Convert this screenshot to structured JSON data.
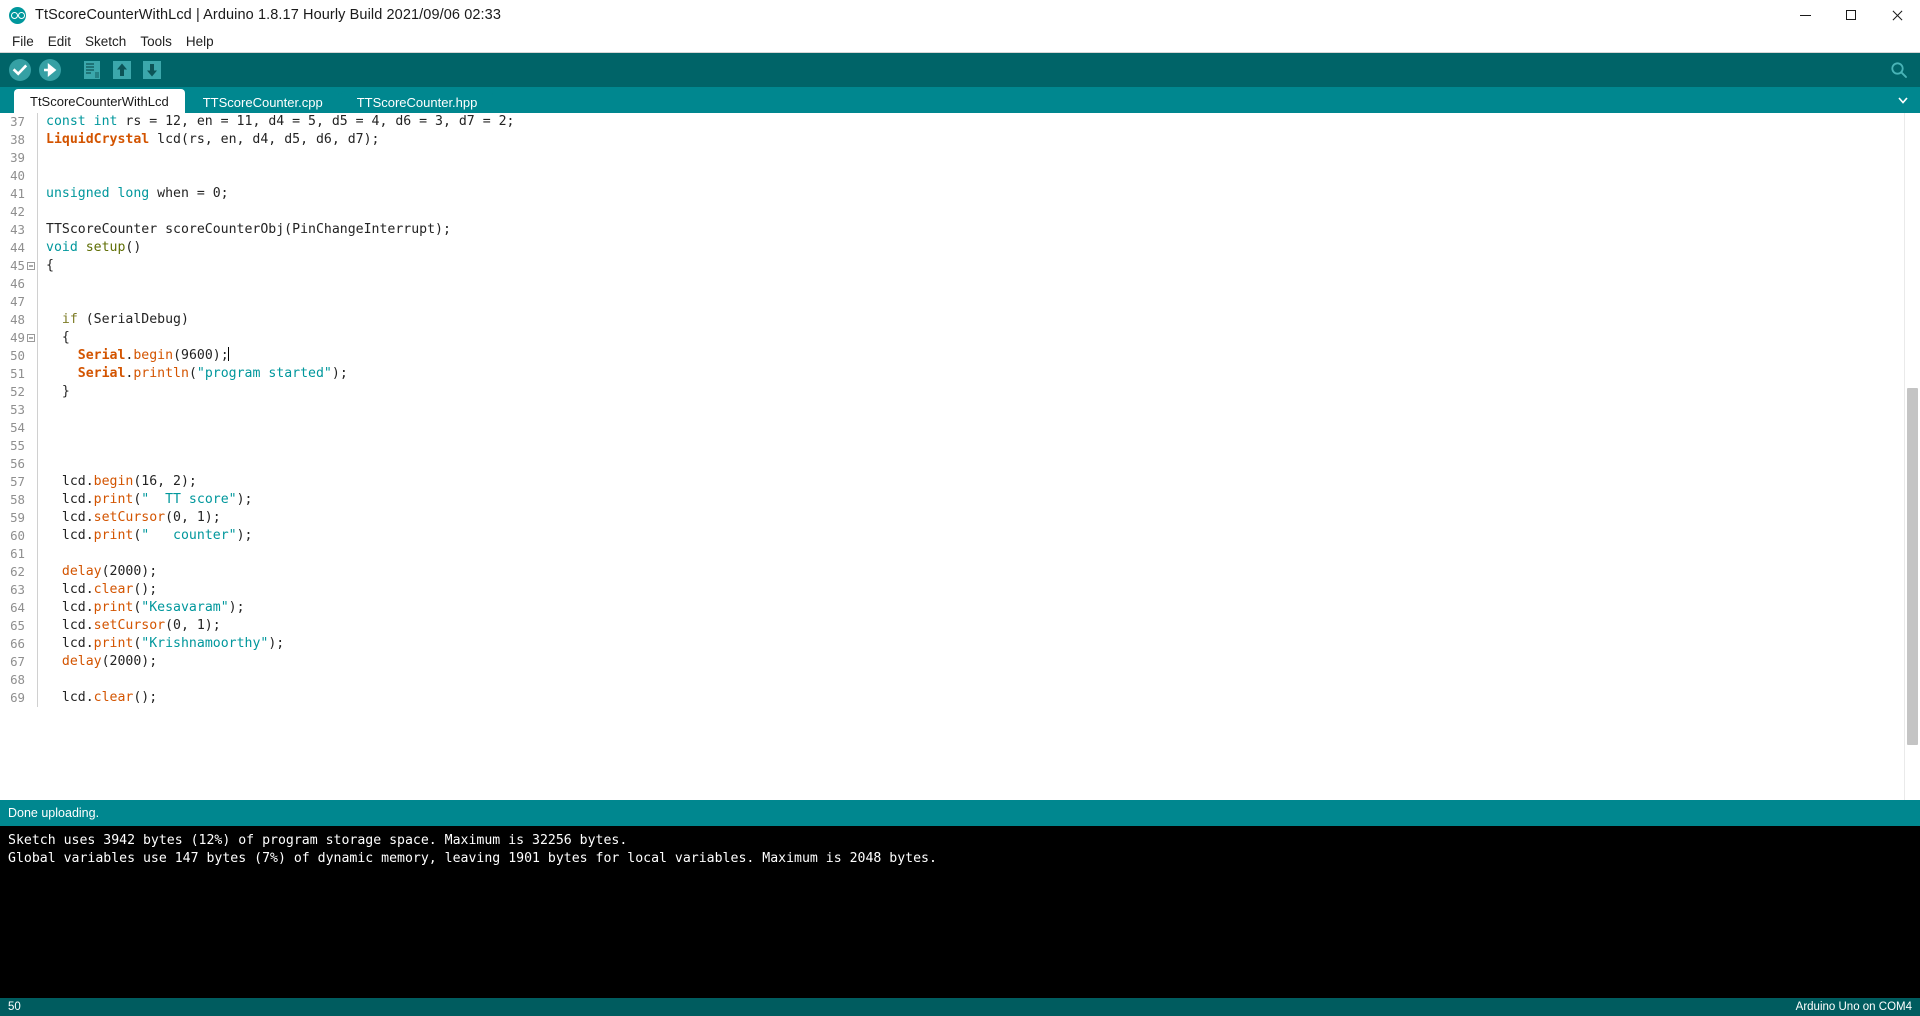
{
  "window": {
    "title": "TtScoreCounterWithLcd | Arduino 1.8.17 Hourly Build 2021/09/06 02:33",
    "logo_icon": "arduino-logo-icon",
    "minimize_icon": "minimize-icon",
    "maximize_icon": "maximize-icon",
    "close_icon": "close-icon"
  },
  "menubar": {
    "items": [
      {
        "label": "File"
      },
      {
        "label": "Edit"
      },
      {
        "label": "Sketch"
      },
      {
        "label": "Tools"
      },
      {
        "label": "Help"
      }
    ]
  },
  "toolbar": {
    "buttons": [
      {
        "name": "verify-button",
        "icon": "check-icon",
        "tooltip": "Verify"
      },
      {
        "name": "upload-button",
        "icon": "arrow-right-icon",
        "tooltip": "Upload"
      },
      {
        "name": "new-button",
        "icon": "new-file-icon",
        "tooltip": "New"
      },
      {
        "name": "open-button",
        "icon": "arrow-up-icon",
        "tooltip": "Open"
      },
      {
        "name": "save-button",
        "icon": "arrow-down-icon",
        "tooltip": "Save"
      }
    ],
    "serial_monitor": {
      "name": "serial-monitor-button",
      "icon": "magnifier-icon",
      "tooltip": "Serial Monitor"
    },
    "background_color": "#006468"
  },
  "tabs": {
    "items": [
      {
        "label": "TtScoreCounterWithLcd",
        "active": true
      },
      {
        "label": "TTScoreCounter.cpp",
        "active": false
      },
      {
        "label": "TTScoreCounter.hpp",
        "active": false
      }
    ],
    "menu_icon": "chevron-down-icon"
  },
  "editor": {
    "first_line": 37,
    "lines": [
      {
        "n": 37,
        "fold": false,
        "tokens": [
          {
            "t": "const int",
            "c": "t-kw"
          },
          {
            "t": " rs = 12, en = 11, d4 = 5, d5 = 4, d6 = 3, d7 = 2;",
            "c": "t-plain"
          }
        ]
      },
      {
        "n": 38,
        "fold": false,
        "tokens": [
          {
            "t": "LiquidCrystal",
            "c": "t-lib"
          },
          {
            "t": " lcd(rs, en, d4, d5, d6, d7);",
            "c": "t-plain"
          }
        ]
      },
      {
        "n": 39,
        "fold": false,
        "tokens": []
      },
      {
        "n": 40,
        "fold": false,
        "tokens": []
      },
      {
        "n": 41,
        "fold": false,
        "tokens": [
          {
            "t": "unsigned long",
            "c": "t-kw"
          },
          {
            "t": " when = 0;",
            "c": "t-plain"
          }
        ]
      },
      {
        "n": 42,
        "fold": false,
        "tokens": []
      },
      {
        "n": 43,
        "fold": false,
        "tokens": [
          {
            "t": "TTScoreCounter scoreCounterObj(PinChangeInterrupt);",
            "c": "t-plain"
          }
        ]
      },
      {
        "n": 44,
        "fold": false,
        "tokens": [
          {
            "t": "void",
            "c": "t-kw"
          },
          {
            "t": " ",
            "c": "t-plain"
          },
          {
            "t": "setup",
            "c": "t-fn"
          },
          {
            "t": "()",
            "c": "t-plain"
          }
        ]
      },
      {
        "n": 45,
        "fold": true,
        "tokens": [
          {
            "t": "{",
            "c": "t-plain"
          }
        ]
      },
      {
        "n": 46,
        "fold": false,
        "tokens": []
      },
      {
        "n": 47,
        "fold": false,
        "tokens": []
      },
      {
        "n": 48,
        "fold": false,
        "tokens": [
          {
            "t": "  ",
            "c": "t-plain"
          },
          {
            "t": "if",
            "c": "t-ctl"
          },
          {
            "t": " (SerialDebug)",
            "c": "t-plain"
          }
        ]
      },
      {
        "n": 49,
        "fold": true,
        "tokens": [
          {
            "t": "  {",
            "c": "t-plain"
          }
        ]
      },
      {
        "n": 50,
        "fold": false,
        "caret": true,
        "tokens": [
          {
            "t": "    ",
            "c": "t-plain"
          },
          {
            "t": "Serial",
            "c": "t-lib"
          },
          {
            "t": ".",
            "c": "t-plain"
          },
          {
            "t": "begin",
            "c": "t-mth"
          },
          {
            "t": "(9600);",
            "c": "t-plain"
          }
        ]
      },
      {
        "n": 51,
        "fold": false,
        "tokens": [
          {
            "t": "    ",
            "c": "t-plain"
          },
          {
            "t": "Serial",
            "c": "t-lib"
          },
          {
            "t": ".",
            "c": "t-plain"
          },
          {
            "t": "println",
            "c": "t-mth"
          },
          {
            "t": "(",
            "c": "t-plain"
          },
          {
            "t": "\"program started\"",
            "c": "t-str"
          },
          {
            "t": ");",
            "c": "t-plain"
          }
        ]
      },
      {
        "n": 52,
        "fold": false,
        "tokens": [
          {
            "t": "  }",
            "c": "t-plain"
          }
        ]
      },
      {
        "n": 53,
        "fold": false,
        "tokens": []
      },
      {
        "n": 54,
        "fold": false,
        "tokens": []
      },
      {
        "n": 55,
        "fold": false,
        "tokens": []
      },
      {
        "n": 56,
        "fold": false,
        "tokens": []
      },
      {
        "n": 57,
        "fold": false,
        "tokens": [
          {
            "t": "  lcd.",
            "c": "t-plain"
          },
          {
            "t": "begin",
            "c": "t-mth"
          },
          {
            "t": "(16, 2);",
            "c": "t-plain"
          }
        ]
      },
      {
        "n": 58,
        "fold": false,
        "tokens": [
          {
            "t": "  lcd.",
            "c": "t-plain"
          },
          {
            "t": "print",
            "c": "t-mth"
          },
          {
            "t": "(",
            "c": "t-plain"
          },
          {
            "t": "\"  TT score\"",
            "c": "t-str"
          },
          {
            "t": ");",
            "c": "t-plain"
          }
        ]
      },
      {
        "n": 59,
        "fold": false,
        "tokens": [
          {
            "t": "  lcd.",
            "c": "t-plain"
          },
          {
            "t": "setCursor",
            "c": "t-mth"
          },
          {
            "t": "(0, 1);",
            "c": "t-plain"
          }
        ]
      },
      {
        "n": 60,
        "fold": false,
        "tokens": [
          {
            "t": "  lcd.",
            "c": "t-plain"
          },
          {
            "t": "print",
            "c": "t-mth"
          },
          {
            "t": "(",
            "c": "t-plain"
          },
          {
            "t": "\"   counter\"",
            "c": "t-str"
          },
          {
            "t": ");",
            "c": "t-plain"
          }
        ]
      },
      {
        "n": 61,
        "fold": false,
        "tokens": []
      },
      {
        "n": 62,
        "fold": false,
        "tokens": [
          {
            "t": "  ",
            "c": "t-plain"
          },
          {
            "t": "delay",
            "c": "t-mth"
          },
          {
            "t": "(2000);",
            "c": "t-plain"
          }
        ]
      },
      {
        "n": 63,
        "fold": false,
        "tokens": [
          {
            "t": "  lcd.",
            "c": "t-plain"
          },
          {
            "t": "clear",
            "c": "t-mth"
          },
          {
            "t": "();",
            "c": "t-plain"
          }
        ]
      },
      {
        "n": 64,
        "fold": false,
        "tokens": [
          {
            "t": "  lcd.",
            "c": "t-plain"
          },
          {
            "t": "print",
            "c": "t-mth"
          },
          {
            "t": "(",
            "c": "t-plain"
          },
          {
            "t": "\"Kesavaram\"",
            "c": "t-str"
          },
          {
            "t": ");",
            "c": "t-plain"
          }
        ]
      },
      {
        "n": 65,
        "fold": false,
        "tokens": [
          {
            "t": "  lcd.",
            "c": "t-plain"
          },
          {
            "t": "setCursor",
            "c": "t-mth"
          },
          {
            "t": "(0, 1);",
            "c": "t-plain"
          }
        ]
      },
      {
        "n": 66,
        "fold": false,
        "tokens": [
          {
            "t": "  lcd.",
            "c": "t-plain"
          },
          {
            "t": "print",
            "c": "t-mth"
          },
          {
            "t": "(",
            "c": "t-plain"
          },
          {
            "t": "\"Krishnamoorthy\"",
            "c": "t-str"
          },
          {
            "t": ");",
            "c": "t-plain"
          }
        ]
      },
      {
        "n": 67,
        "fold": false,
        "tokens": [
          {
            "t": "  ",
            "c": "t-plain"
          },
          {
            "t": "delay",
            "c": "t-mth"
          },
          {
            "t": "(2000);",
            "c": "t-plain"
          }
        ]
      },
      {
        "n": 68,
        "fold": false,
        "tokens": []
      },
      {
        "n": 69,
        "fold": false,
        "tokens": [
          {
            "t": "  lcd.",
            "c": "t-plain"
          },
          {
            "t": "clear",
            "c": "t-mth"
          },
          {
            "t": "();",
            "c": "t-plain"
          }
        ]
      }
    ]
  },
  "status": {
    "message": "Done uploading."
  },
  "console": {
    "lines": [
      "Sketch uses 3942 bytes (12%) of program storage space. Maximum is 32256 bytes.",
      "Global variables use 147 bytes (7%) of dynamic memory, leaving 1901 bytes for local variables. Maximum is 2048 bytes."
    ]
  },
  "bottombar": {
    "line_number": "50",
    "board_info": "Arduino Uno on COM4"
  }
}
